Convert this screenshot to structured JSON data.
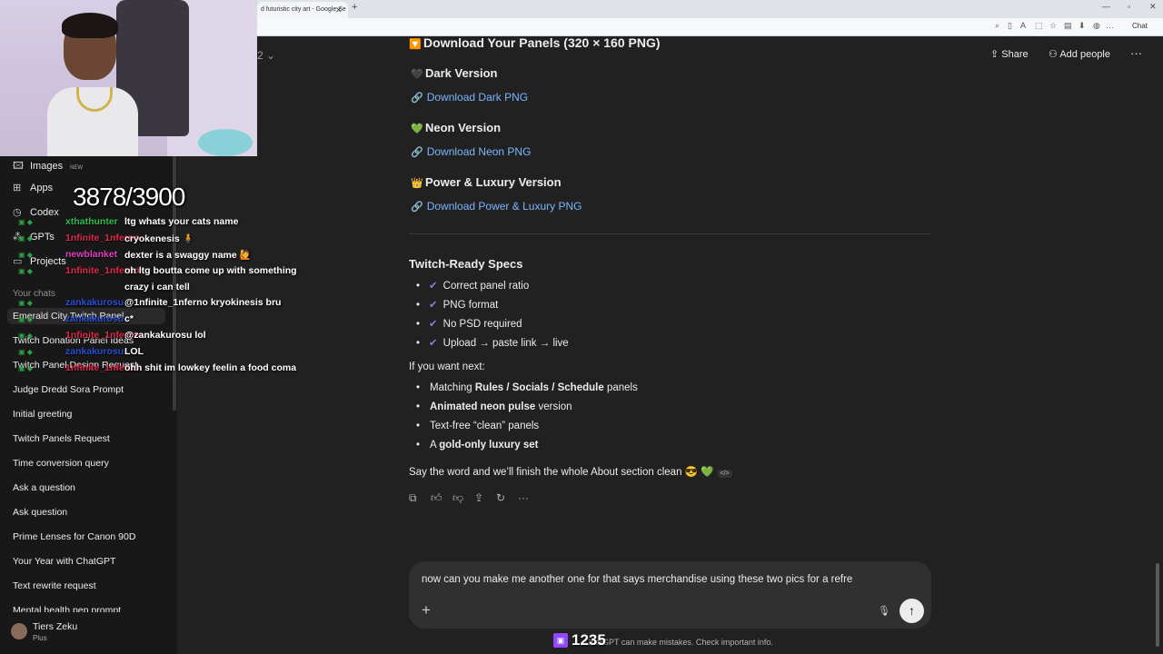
{
  "browser": {
    "tab_title": "d futuristic city art - Google Se",
    "tab_close": "✕",
    "new_tab": "+",
    "chat_badge": "Chat"
  },
  "header": {
    "model_suffix": "2",
    "share_label": "Share",
    "add_people_label": "Add people",
    "more": "···"
  },
  "sidebar": {
    "items": [
      {
        "label": "Images",
        "icon": "images-icon",
        "glyph": "🖾",
        "badge": "NEW"
      },
      {
        "label": "Apps",
        "icon": "apps-icon",
        "glyph": "⊞"
      },
      {
        "label": "Codex",
        "icon": "codex-icon",
        "glyph": "◷"
      },
      {
        "label": "GPTs",
        "icon": "gpts-icon",
        "glyph": "⁂"
      },
      {
        "label": "Projects",
        "icon": "folder-icon",
        "glyph": "▭"
      }
    ],
    "section_label": "Your chats",
    "chats": [
      "Emerald City Twitch Panel",
      "Twitch Donation Panel Ideas",
      "Twitch Panel Design Request",
      "Judge Dredd Sora Prompt",
      "Initial greeting",
      "Twitch Panels Request",
      "Time conversion query",
      "Ask a question",
      "Ask question",
      "Prime Lenses for Canon 90D",
      "Your Year with ChatGPT",
      "Text rewrite request",
      "Mental health pep prompt"
    ],
    "profile": {
      "name": "Tiers Zeku",
      "plan": "Plus"
    }
  },
  "overlay": {
    "counter": "3878/3900",
    "chat": [
      {
        "user": "xthathunter",
        "color": "#2fbf4a",
        "msg": "ltg whats your cats name"
      },
      {
        "user": "1nfinite_1nferno",
        "color": "#e0294a",
        "msg": "cryokenesis 🧍"
      },
      {
        "user": "newblanket",
        "color": "#e040c0",
        "msg": "dexter is a swaggy name 🙋"
      },
      {
        "user": "1nfinite_1nferno",
        "color": "#e0294a",
        "msg": "oh ltg boutta come up with something"
      },
      {
        "user": "",
        "color": "#ffffff",
        "msg": "crazy i can tell"
      },
      {
        "user": "zankakurosu",
        "color": "#2a4fd6",
        "msg": "@1nfinite_1nferno kryokinesis bru"
      },
      {
        "user": "zankakurosu",
        "color": "#2a4fd6",
        "msg": "c*"
      },
      {
        "user": "1nfinite_1nferno",
        "color": "#e0294a",
        "msg": "@zankakurosu lol"
      },
      {
        "user": "zankakurosu",
        "color": "#2a4fd6",
        "msg": "LOL"
      },
      {
        "user": "1nfinite_1nferno",
        "color": "#e0294a",
        "msg": "ohh shit im lowkey feelin a food coma"
      }
    ],
    "viewers": "1235"
  },
  "content": {
    "title": "Download Your Panels (320 × 160 PNG)",
    "versions": [
      {
        "emoji": "🖤",
        "heading": "Dark Version",
        "link": "Download Dark PNG"
      },
      {
        "emoji": "💚",
        "heading": "Neon Version",
        "link": "Download Neon PNG"
      },
      {
        "emoji": "👑",
        "heading": "Power & Luxury Version",
        "link": "Download Power & Luxury PNG"
      }
    ],
    "specs_title": "Twitch-Ready Specs",
    "specs": [
      "Correct panel ratio",
      "PNG format",
      "No PSD required",
      "Upload → paste link → live"
    ],
    "next_title": "If you want next:",
    "next_items": [
      {
        "pre": "Matching ",
        "bold": "Rules / Socials / Schedule",
        "post": " panels"
      },
      {
        "pre": "",
        "bold": "Animated neon pulse",
        "post": " version"
      },
      {
        "pre": "Text-free “clean” panels",
        "bold": "",
        "post": ""
      },
      {
        "pre": "A ",
        "bold": "gold-only luxury set",
        "post": ""
      }
    ],
    "closing": "Say the word and we’ll finish the whole About section clean 😎 💚",
    "code_chip": "</>"
  },
  "composer": {
    "input_value": "now can you make me another one for that says merchandise using these two pics for a refre",
    "plus": "+",
    "send": "↑"
  },
  "footer": {
    "disclaimer": "ChatGPT can make mistakes. Check important info."
  }
}
